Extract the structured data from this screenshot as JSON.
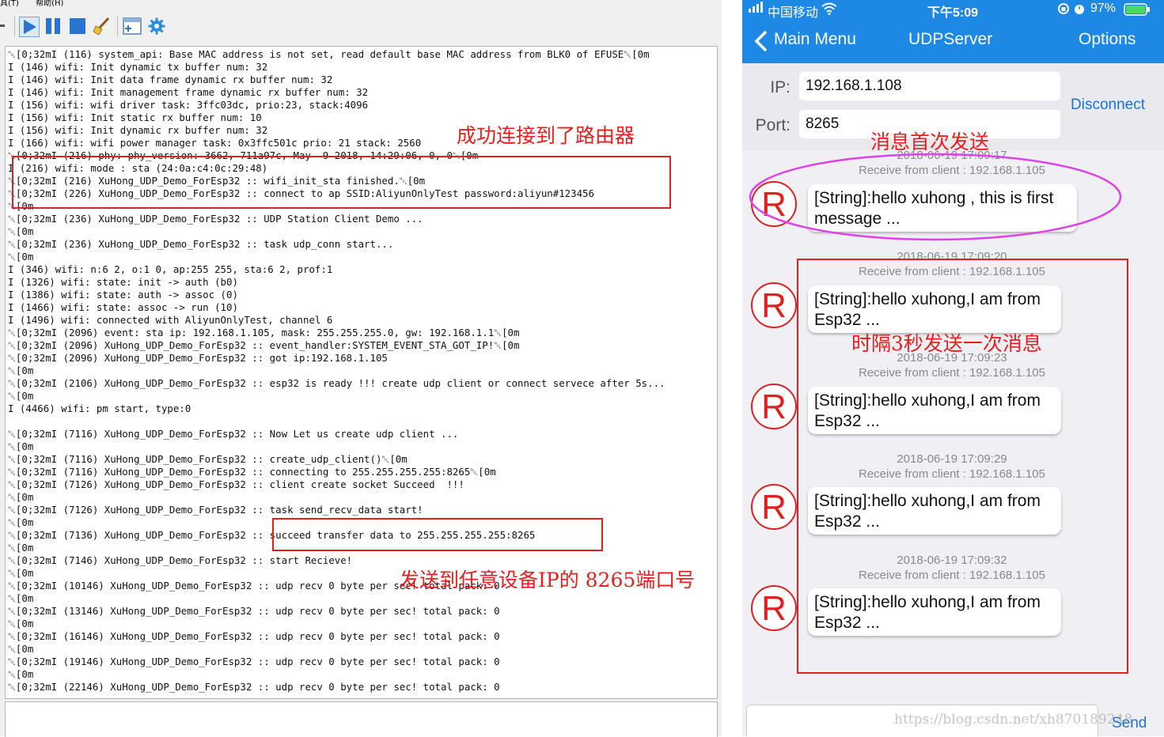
{
  "menu": [
    "具(T)",
    "帮助(H)"
  ],
  "toolbar": {
    "tools": [
      "play-icon",
      "pause-icon",
      "stop-icon",
      "broom-icon",
      "add-window-icon",
      "gear-icon"
    ]
  },
  "console": {
    "lines": [
      "␀[0;32mI (116) system_api: Base MAC address is not set, read default base MAC address from BLK0 of EFUSE␀[0m",
      "I (146) wifi: Init dynamic tx buffer num: 32",
      "I (146) wifi: Init data frame dynamic rx buffer num: 32",
      "I (146) wifi: Init management frame dynamic rx buffer num: 32",
      "I (156) wifi: wifi driver task: 3ffc03dc, prio:23, stack:4096",
      "I (156) wifi: Init static rx buffer num: 10",
      "I (156) wifi: Init dynamic rx buffer num: 32",
      "I (166) wifi: wifi power manager task: 0x3ffc501c prio: 21 stack: 2560",
      "␀[0;32mI (216) phy: phy_version: 3662, 711a97c, May  9 2018, 14:29:06, 0, 0␀[0m",
      "I (216) wifi: mode : sta (24:0a:c4:0c:29:48)",
      "␀[0;32mI (216) XuHong_UDP_Demo_ForEsp32 :: wifi_init_sta finished.␀[0m",
      "␀[0;32mI (226) XuHong_UDP_Demo_ForEsp32 :: connect to ap SSID:AliyunOnlyTest password:aliyun#123456",
      "␀[0m",
      "␀[0;32mI (236) XuHong_UDP_Demo_ForEsp32 :: UDP Station Client Demo ...",
      "␀[0m",
      "␀[0;32mI (236) XuHong_UDP_Demo_ForEsp32 :: task udp_conn start...",
      "␀[0m",
      "I (346) wifi: n:6 2, o:1 0, ap:255 255, sta:6 2, prof:1",
      "I (1326) wifi: state: init -> auth (b0)",
      "I (1386) wifi: state: auth -> assoc (0)",
      "I (1466) wifi: state: assoc -> run (10)",
      "I (1496) wifi: connected with AliyunOnlyTest, channel 6",
      "␀[0;32mI (2096) event: sta ip: 192.168.1.105, mask: 255.255.255.0, gw: 192.168.1.1␀[0m",
      "␀[0;32mI (2096) XuHong_UDP_Demo_ForEsp32 :: event_handler:SYSTEM_EVENT_STA_GOT_IP!␀[0m",
      "␀[0;32mI (2096) XuHong_UDP_Demo_ForEsp32 :: got ip:192.168.1.105",
      "␀[0m",
      "␀[0;32mI (2106) XuHong_UDP_Demo_ForEsp32 :: esp32 is ready !!! create udp client or connect servece after 5s...",
      "␀[0m",
      "I (4466) wifi: pm start, type:0",
      "",
      "␀[0;32mI (7116) XuHong_UDP_Demo_ForEsp32 :: Now Let us create udp client ...",
      "␀[0m",
      "␀[0;32mI (7116) XuHong_UDP_Demo_ForEsp32 :: create_udp_client()␀[0m",
      "␀[0;32mI (7116) XuHong_UDP_Demo_ForEsp32 :: connecting to 255.255.255.255:8265␀[0m",
      "␀[0;32mI (7126) XuHong_UDP_Demo_ForEsp32 :: client create socket Succeed  !!!",
      "␀[0m",
      "␀[0;32mI (7126) XuHong_UDP_Demo_ForEsp32 :: task send_recv_data start!",
      "␀[0m",
      "␀[0;32mI (7136) XuHong_UDP_Demo_ForEsp32 :: succeed transfer data to 255.255.255.255:8265",
      "␀[0m",
      "␀[0;32mI (7146) XuHong_UDP_Demo_ForEsp32 :: start Recieve!",
      "␀[0m",
      "␀[0;32mI (10146) XuHong_UDP_Demo_ForEsp32 :: udp recv 0 byte per sec! total pack: 0",
      "␀[0m",
      "␀[0;32mI (13146) XuHong_UDP_Demo_ForEsp32 :: udp recv 0 byte per sec! total pack: 0",
      "␀[0m",
      "␀[0;32mI (16146) XuHong_UDP_Demo_ForEsp32 :: udp recv 0 byte per sec! total pack: 0",
      "␀[0m",
      "␀[0;32mI (19146) XuHong_UDP_Demo_ForEsp32 :: udp recv 0 byte per sec! total pack: 0",
      "␀[0m",
      "␀[0;32mI (22146) XuHong_UDP_Demo_ForEsp32 :: udp recv 0 byte per sec! total pack: 0"
    ]
  },
  "annotations": {
    "router_connected": "成功连接到了路由器",
    "send_any_ip": "发送到任意设备IP的 8265端口号",
    "first_send": "消息首次发送",
    "interval": "时隔3秒发送一次消息"
  },
  "phone": {
    "status": {
      "carrier": "中国移动",
      "time": "下午5:09",
      "battery": "97%"
    },
    "nav": {
      "back_label": "Main Menu",
      "title": "UDPServer",
      "options_label": "Options"
    },
    "form": {
      "ip_label": "IP:",
      "ip_value": "192.168.1.108",
      "port_label": "Port:",
      "port_value": "8265",
      "disconnect_label": "Disconnect"
    },
    "avatar_letter": "R",
    "messages": [
      {
        "time": "2018-06-19 17:09:17",
        "from": "Receive from client : 192.168.1.105",
        "text": "[String]:hello xuhong , this is first message ..."
      },
      {
        "time": "2018-06-19 17:09:20",
        "from": "Receive from client : 192.168.1.105",
        "text": "[String]:hello xuhong,I am from Esp32 ..."
      },
      {
        "time": "2018-06-19 17:09:23",
        "from": "Receive from client : 192.168.1.105",
        "text": "[String]:hello xuhong,I am from Esp32 ..."
      },
      {
        "time": "2018-06-19 17:09:29",
        "from": "Receive from client : 192.168.1.105",
        "text": "[String]:hello xuhong,I am from Esp32 ..."
      },
      {
        "time": "2018-06-19 17:09:32",
        "from": "Receive from client : 192.168.1.105",
        "text": "[String]:hello xuhong,I am from Esp32 ..."
      }
    ],
    "send_label": "Send"
  },
  "watermark": "https://blog.csdn.net/xh870189248",
  "colors": {
    "accent": "#1e88e5",
    "annotation": "#ee1c1c",
    "ellipse": "#e040e8",
    "link": "#1a73d8"
  }
}
